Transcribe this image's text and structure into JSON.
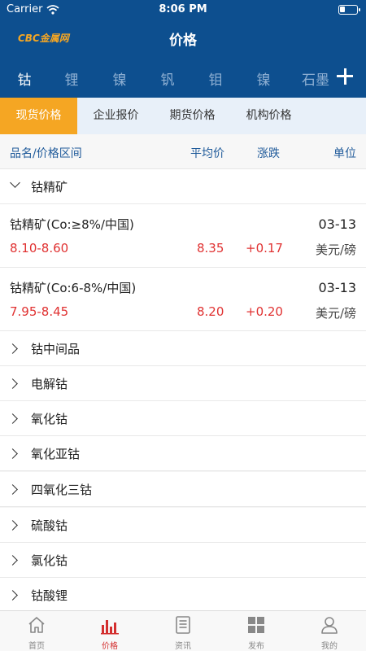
{
  "status": {
    "carrier": "Carrier",
    "time": "8:06 PM"
  },
  "header": {
    "logo": "CBC金属网",
    "title": "价格"
  },
  "metal_tabs": [
    "钴",
    "锂",
    "镍",
    "钒",
    "钼",
    "镍",
    "石墨"
  ],
  "price_tabs": [
    "现货价格",
    "企业报价",
    "期货价格",
    "机构价格"
  ],
  "columns": {
    "name": "品名/价格区间",
    "avg": "平均价",
    "change": "涨跌",
    "unit": "单位"
  },
  "expanded_group": "钴精矿",
  "items": [
    {
      "name": "钴精矿(Co:≥8%/中国)",
      "date": "03-13",
      "range": "8.10-8.60",
      "avg": "8.35",
      "change": "+0.17",
      "unit": "美元/磅"
    },
    {
      "name": "钴精矿(Co:6-8%/中国)",
      "date": "03-13",
      "range": "7.95-8.45",
      "avg": "8.20",
      "change": "+0.20",
      "unit": "美元/磅"
    }
  ],
  "groups": [
    "钴中间品",
    "电解钴",
    "氧化钴",
    "氧化亚钴",
    "四氧化三钴",
    "硫酸钴",
    "氯化钴",
    "钴酸锂"
  ],
  "tab_bar": [
    {
      "label": "首页",
      "icon": "home-icon"
    },
    {
      "label": "价格",
      "icon": "bar-chart-icon"
    },
    {
      "label": "资讯",
      "icon": "news-icon"
    },
    {
      "label": "发布",
      "icon": "grid-icon"
    },
    {
      "label": "我的",
      "icon": "user-icon"
    }
  ],
  "colors": {
    "brand": "#0d4f8f",
    "accent": "#f5a623",
    "up": "#e03131",
    "active_tab": "#d32f2f"
  }
}
